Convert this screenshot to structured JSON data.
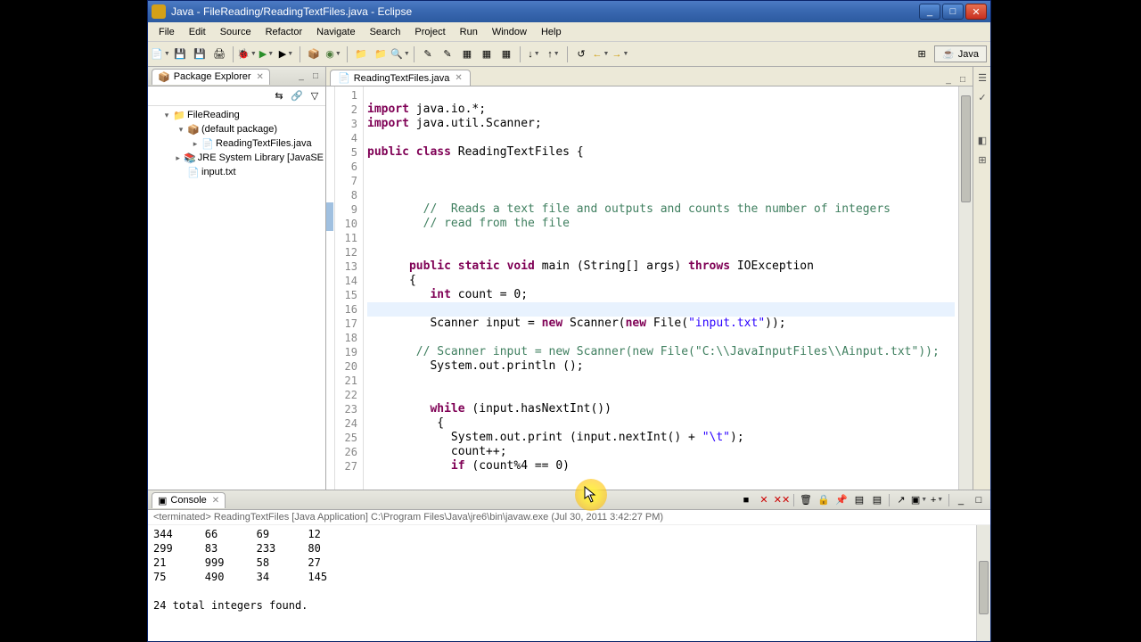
{
  "window": {
    "title": "Java - FileReading/ReadingTextFiles.java - Eclipse"
  },
  "menu": [
    "File",
    "Edit",
    "Source",
    "Refactor",
    "Navigate",
    "Search",
    "Project",
    "Run",
    "Window",
    "Help"
  ],
  "perspective": {
    "label": "Java"
  },
  "packageExplorer": {
    "title": "Package Explorer",
    "tree": {
      "project": "FileReading",
      "defaultPkg": "(default package)",
      "javaFile": "ReadingTextFiles.java",
      "jre": "JRE System Library [JavaSE",
      "inputFile": "input.txt"
    }
  },
  "editor": {
    "tab": "ReadingTextFiles.java",
    "lines": [
      {
        "n": 1,
        "html": ""
      },
      {
        "n": 2,
        "html": "<span class='kw'>import</span> java.io.*;"
      },
      {
        "n": 3,
        "html": "<span class='kw'>import</span> java.util.Scanner;"
      },
      {
        "n": 4,
        "html": ""
      },
      {
        "n": 5,
        "html": "<span class='kw'>public</span> <span class='kw'>class</span> ReadingTextFiles {"
      },
      {
        "n": 6,
        "html": ""
      },
      {
        "n": 7,
        "html": ""
      },
      {
        "n": 8,
        "html": ""
      },
      {
        "n": 9,
        "html": "        <span class='cm'>//  Reads a text file and outputs and counts the number of integers</span>"
      },
      {
        "n": 10,
        "html": "        <span class='cm'>// read from the file</span>"
      },
      {
        "n": 11,
        "html": ""
      },
      {
        "n": 12,
        "html": ""
      },
      {
        "n": 13,
        "html": "      <span class='kw'>public</span> <span class='kw'>static</span> <span class='kw'>void</span> main (String[] args) <span class='kw'>throws</span> IOException"
      },
      {
        "n": 14,
        "html": "      {"
      },
      {
        "n": 15,
        "html": "         <span class='kw'>int</span> count = 0;"
      },
      {
        "n": 16,
        "html": "",
        "hl": true
      },
      {
        "n": 17,
        "html": "         Scanner input = <span class='kw'>new</span> Scanner(<span class='kw'>new</span> File(<span class='str'>\"input.txt\"</span>));"
      },
      {
        "n": 18,
        "html": ""
      },
      {
        "n": 19,
        "html": "       <span class='cm'>// Scanner input = new Scanner(new File(\"C:\\\\JavaInputFiles\\\\Ainput.txt\"));</span>"
      },
      {
        "n": 20,
        "html": "         System.out.println ();"
      },
      {
        "n": 21,
        "html": ""
      },
      {
        "n": 22,
        "html": ""
      },
      {
        "n": 23,
        "html": "         <span class='kw'>while</span> (input.hasNextInt())"
      },
      {
        "n": 24,
        "html": "          {"
      },
      {
        "n": 25,
        "html": "            System.out.print (input.nextInt() + <span class='str'>\"\\t\"</span>);"
      },
      {
        "n": 26,
        "html": "            count++;"
      },
      {
        "n": 27,
        "html": "            <span class='kw'>if</span> (count%4 == 0)"
      }
    ]
  },
  "console": {
    "title": "Console",
    "status": "<terminated> ReadingTextFiles [Java Application] C:\\Program Files\\Java\\jre6\\bin\\javaw.exe (Jul 30, 2011 3:42:27 PM)",
    "output": "344\t66\t69\t12\n299\t83\t233\t80\n21\t999\t58\t27\n75\t490\t34\t145\n\n24 total integers found."
  }
}
